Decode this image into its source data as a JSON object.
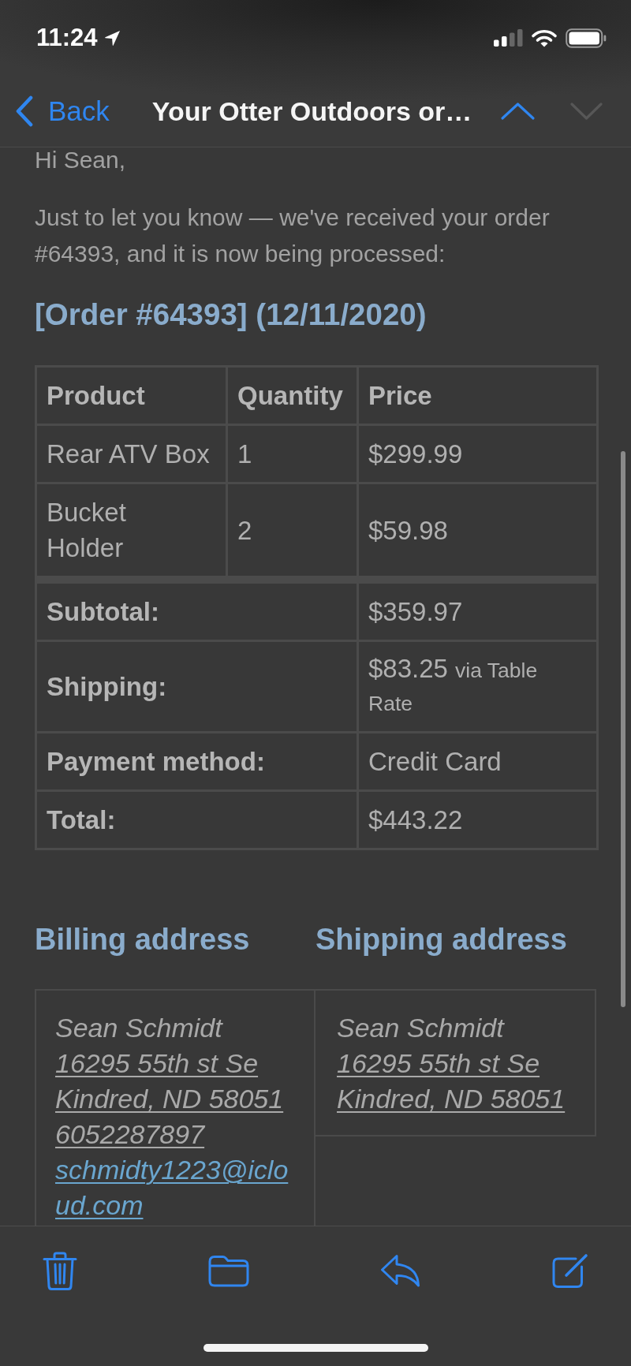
{
  "status_bar": {
    "time": "11:24"
  },
  "nav_bar": {
    "back": "Back",
    "title": "Your Otter Outdoors or…",
    "message_arrows": [
      {
        "kind": "up",
        "disabled": false
      },
      {
        "kind": "down",
        "disabled": true
      }
    ]
  },
  "email": {
    "greeting": "Hi Sean,",
    "intro": "Just to let you know — we've received your order #64393, and it is now being processed:",
    "order_heading": "[Order #64393] (12/11/2020)",
    "order_table": {
      "columns": [
        "Product",
        "Quantity",
        "Price"
      ],
      "rows": [
        [
          "Rear ATV Box",
          "1",
          "$299.99"
        ],
        [
          "Bucket\nHolder",
          "2",
          "$59.98"
        ]
      ],
      "totals": [
        {
          "label": "Subtotal:",
          "value": "$359.97"
        },
        {
          "label": "Shipping:",
          "value": "$83.25",
          "note": "via Table Rate"
        },
        {
          "label": "Payment method:",
          "value": "Credit Card"
        },
        {
          "label": "Total:",
          "value": "$443.22"
        }
      ]
    },
    "addresses": [
      {
        "title": "Billing address",
        "lines": [
          {
            "kind": "name",
            "text": "Sean Schmidt"
          },
          {
            "kind": "address",
            "text": "16295 55th st Se"
          },
          {
            "kind": "address",
            "text": "Kindred, ND 58051"
          },
          {
            "kind": "phone",
            "text": "6052287897"
          },
          {
            "kind": "email",
            "text": "schmidty1223@icloud.com"
          }
        ]
      },
      {
        "title": "Shipping address",
        "lines": [
          {
            "kind": "name",
            "text": "Sean Schmidt"
          },
          {
            "kind": "address",
            "text": "16295 55th st Se"
          },
          {
            "kind": "address",
            "text": "Kindred, ND 58051"
          }
        ]
      }
    ]
  }
}
